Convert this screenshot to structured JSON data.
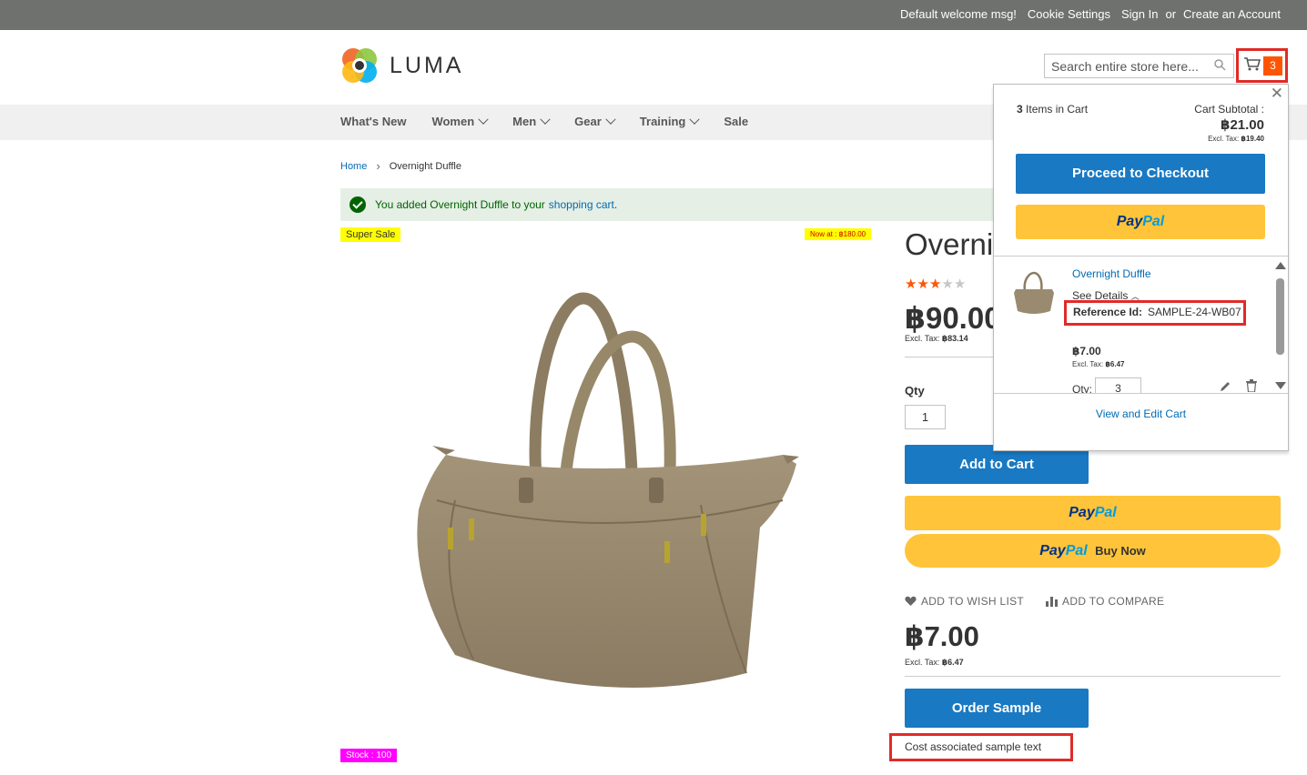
{
  "topbar": {
    "welcome": "Default welcome msg!",
    "cookie": "Cookie Settings",
    "sign_in": "Sign In",
    "or": "or",
    "create_account": "Create an Account"
  },
  "header": {
    "logo_text": "LUMA",
    "search_placeholder": "Search entire store here...",
    "cart_count": "3"
  },
  "nav": {
    "items": [
      {
        "label": "What's New",
        "dropdown": false
      },
      {
        "label": "Women",
        "dropdown": true
      },
      {
        "label": "Men",
        "dropdown": true
      },
      {
        "label": "Gear",
        "dropdown": true
      },
      {
        "label": "Training",
        "dropdown": true
      },
      {
        "label": "Sale",
        "dropdown": false
      }
    ]
  },
  "breadcrumb": {
    "home": "Home",
    "current": "Overnight Duffle"
  },
  "message": {
    "prefix": "You added Overnight Duffle to your",
    "link": "shopping cart",
    "suffix": "."
  },
  "badges": {
    "super_sale": "Super Sale",
    "now_at": "Now at : ฿180.00",
    "stock": "Stock : 100"
  },
  "product": {
    "title": "Overnight Duffle",
    "rating": 3,
    "rating_max": 5,
    "price": "฿90.00",
    "excl_tax_label": "Excl. Tax:",
    "excl_tax_value": "฿83.14",
    "qty_label": "Qty",
    "qty_value": "1",
    "add_to_cart": "Add to Cart",
    "paypal_buy_now": "Buy Now",
    "add_to_wishlist": "ADD TO WISH LIST",
    "add_to_compare": "ADD TO COMPARE",
    "sample_price": "฿7.00",
    "sample_excl_tax_value": "฿6.47",
    "order_sample": "Order Sample",
    "cost_text": "Cost associated sample text"
  },
  "paypal": {
    "pay": "Pay",
    "pal": "Pal"
  },
  "minicart": {
    "count": "3",
    "count_label": "Items in Cart",
    "subtotal_label": "Cart Subtotal :",
    "subtotal_value": "฿21.00",
    "subtotal_tax_label": "Excl. Tax:",
    "subtotal_tax_value": "฿19.40",
    "checkout": "Proceed to Checkout",
    "item": {
      "name": "Overnight Duffle",
      "see_details": "See Details",
      "reference_label": "Reference Id:",
      "reference_value": "SAMPLE-24-WB07",
      "price": "฿7.00",
      "tax_label": "Excl. Tax:",
      "tax_value": "฿6.47",
      "qty_label": "Qty:",
      "qty_value": "3"
    },
    "view_edit": "View and Edit Cart"
  },
  "colors": {
    "primary_blue": "#1979c3",
    "paypal_yellow": "#ffc439",
    "highlight_red": "#e02b27",
    "cart_orange": "#ff5501"
  }
}
